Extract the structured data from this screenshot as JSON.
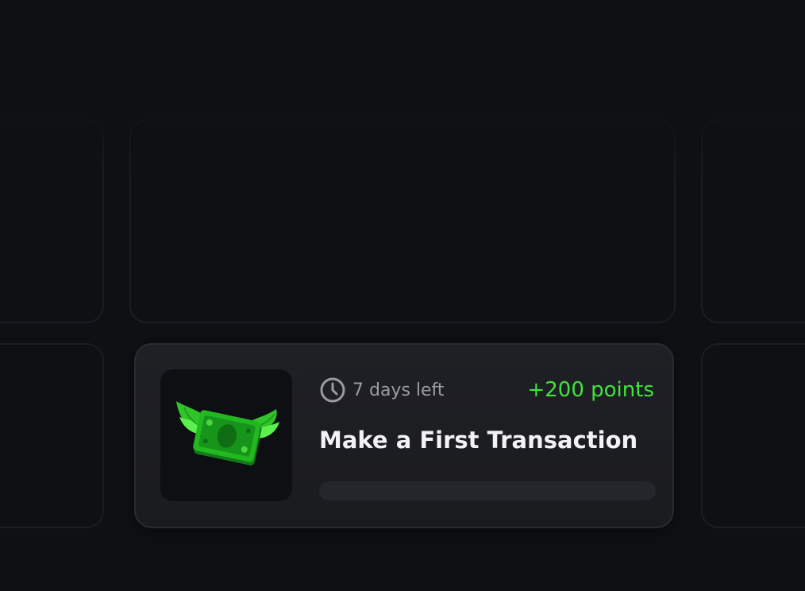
{
  "task": {
    "time_left": "7 days left",
    "points": "+200 points",
    "title": "Make a First Transaction",
    "progress_fraction": 0,
    "image_icon": "winged-money-icon"
  },
  "colors": {
    "background": "#0f1014",
    "card": "#1c1d22",
    "points_green": "#3ee43a",
    "title_text": "#f3f3f5",
    "muted_text": "#9a9ba2"
  }
}
